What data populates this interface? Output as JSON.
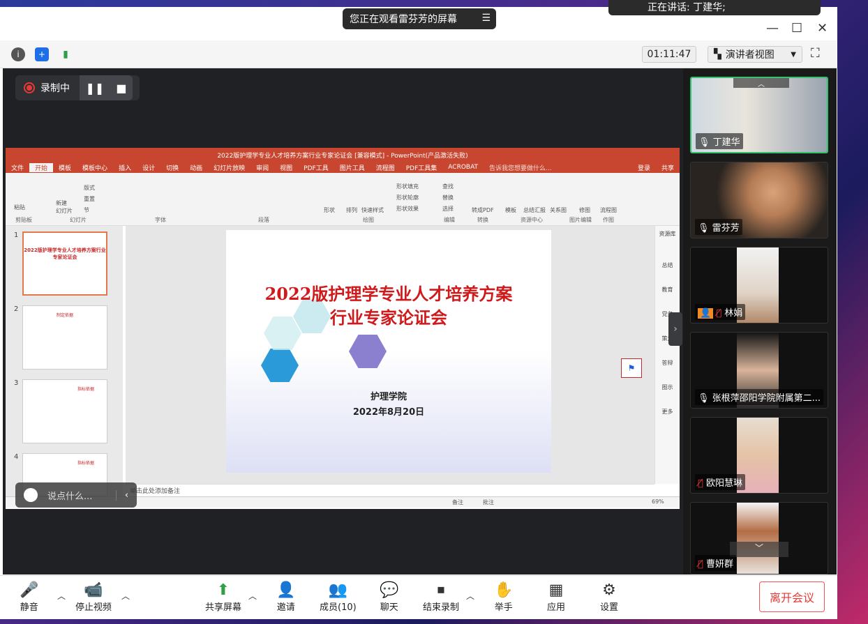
{
  "window": {
    "share_banner": "您正在观看雷芬芳的屏幕",
    "speaker_toast": "正在讲话: 丁建华;",
    "timer": "01:11:47",
    "view_mode": "演讲者视图",
    "recording_label": "录制中"
  },
  "ppt": {
    "title": "2022版护理学专业人才培养方案行业专家论证会 [兼容模式] - PowerPoint(产品激活失败)",
    "tabs": [
      "文件",
      "开始",
      "模板",
      "模板中心",
      "插入",
      "设计",
      "切换",
      "动画",
      "幻灯片放映",
      "审阅",
      "视图",
      "PDF工具",
      "图片工具",
      "流程图",
      "PDF工具集",
      "ACROBAT"
    ],
    "tell_me": "告诉我您想要做什么...",
    "login": "登录",
    "share": "共享",
    "ribbon_groups": [
      "剪贴板",
      "幻灯片",
      "字体",
      "段落",
      "绘图",
      "编辑",
      "转换",
      "资源中心",
      "图片编辑",
      "作图"
    ],
    "ribbon_items": {
      "paste": "粘贴",
      "new_slide": "新建\n幻灯片",
      "layout": "版式",
      "reset": "重置",
      "section": "节",
      "shape": "形状",
      "arrange": "排列",
      "quick_style": "快速样式",
      "shape_fill": "形状填充",
      "shape_outline": "形状轮廓",
      "shape_effect": "形状效果",
      "find": "查找",
      "replace": "替换",
      "select": "选择",
      "to_pdf": "转成PDF",
      "template": "模板",
      "summary": "总结汇报",
      "relation": "关系图",
      "retouch": "修图",
      "flowchart": "流程图"
    },
    "slide": {
      "title_line1": "2022版护理学专业人才培养方案",
      "title_line2": "行业专家论证会",
      "org": "护理学院",
      "date": "2022年8月20日"
    },
    "thumb_numbers": [
      "1",
      "2",
      "3",
      "4"
    ],
    "thumb1_title": "2022版护理学专业人才培养方案行业专家论证会",
    "thumb2_title": "制定依据",
    "thumb3_title": "指标依据",
    "thumb4_title": "指标依据",
    "notes_placeholder": "单击此处添加备注",
    "status": {
      "notes": "备注",
      "comments": "批注",
      "zoom": "69%"
    },
    "right_pane": [
      "资源库",
      "总结",
      "教育",
      "党务",
      "策划",
      "答辩",
      "图示",
      "更多"
    ]
  },
  "chat_placeholder": "说点什么...",
  "participants": [
    {
      "name": "丁建华",
      "mic": "on"
    },
    {
      "name": "雷芬芳",
      "mic": "on"
    },
    {
      "name": "林娟",
      "mic": "muted"
    },
    {
      "name": "张根萍邵阳学院附属第二...",
      "mic": "on"
    },
    {
      "name": "欧阳慧琳",
      "mic": "muted"
    },
    {
      "name": "曹妍群",
      "mic": "muted"
    }
  ],
  "bottom": {
    "mute": "静音",
    "stop_video": "停止视频",
    "share_screen": "共享屏幕",
    "invite": "邀请",
    "members": "成员(10)",
    "chat": "聊天",
    "end_record": "结束录制",
    "raise_hand": "举手",
    "apps": "应用",
    "settings": "设置",
    "leave": "离开会议"
  }
}
